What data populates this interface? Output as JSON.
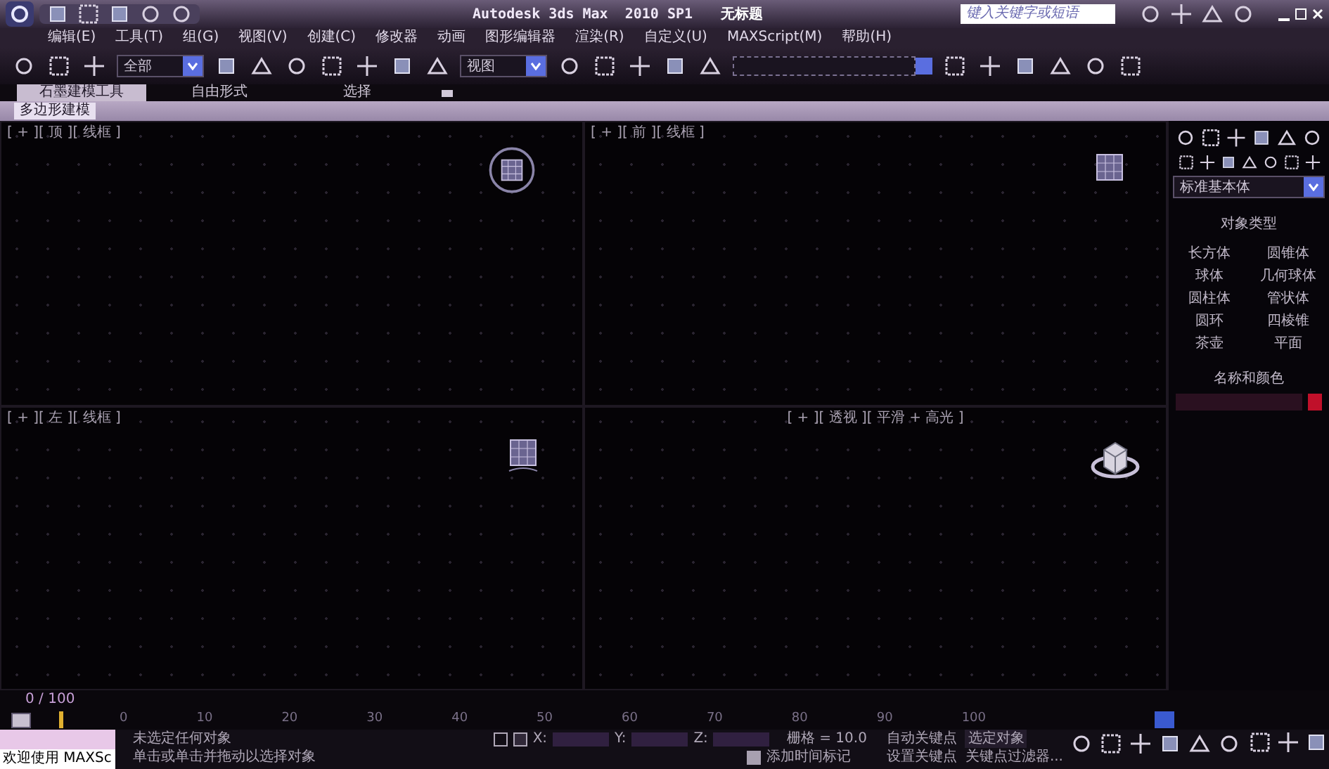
{
  "window": {
    "app_title": "Autodesk 3ds Max  2010 SP1",
    "doc_title": "无标题"
  },
  "search": {
    "placeholder": "键入关键字或短语"
  },
  "menu": [
    "编辑(E)",
    "工具(T)",
    "组(G)",
    "视图(V)",
    "创建(C)",
    "修改器",
    "动画",
    "图形编辑器",
    "渲染(R)",
    "自定义(U)",
    "MAXScript(M)",
    "帮助(H)"
  ],
  "toolbar": {
    "selection_filter": "全部",
    "reference_coord": "视图"
  },
  "ribbon_tabs": [
    {
      "label": "石墨建模工具",
      "selected": true
    },
    {
      "label": "自由形式",
      "selected": false
    },
    {
      "label": "选择",
      "selected": false
    }
  ],
  "ribbon_panel": {
    "label": "多边形建模"
  },
  "viewports": [
    {
      "label": "[ + ][ 顶 ][ 线框 ]",
      "kind": "top"
    },
    {
      "label": "[ + ][ 前 ][ 线框 ]",
      "kind": "front"
    },
    {
      "label": "[ + ][ 左 ][ 线框 ]",
      "kind": "left"
    },
    {
      "label": "[ + ][ 透视 ][ 平滑 + 高光 ]",
      "kind": "perspective"
    }
  ],
  "command_panel": {
    "category": "标准基本体",
    "object_type_title": "对象类型",
    "buttons": [
      "长方体",
      "圆锥体",
      "球体",
      "几何球体",
      "圆柱体",
      "管状体",
      "圆环",
      "四棱锥",
      "茶壶",
      "平面"
    ],
    "name_color_title": "名称和颜色"
  },
  "time_slider": {
    "label": "0 / 100"
  },
  "timeline_ticks": [
    "0",
    "10",
    "20",
    "30",
    "40",
    "50",
    "60",
    "70",
    "80",
    "90",
    "100"
  ],
  "status": {
    "welcome": "欢迎使用 MAXSc",
    "selection": "未选定任何对象",
    "prompt": "单击或单击并拖动以选择对象",
    "x_label": "X:",
    "y_label": "Y:",
    "z_label": "Z:",
    "grid": "栅格 = 10.0",
    "add_time_tag": "添加时间标记",
    "auto_key": "自动关键点",
    "key_mode": "选定对象",
    "set_key": "设置关键点",
    "key_filters": "关键点过滤器..."
  }
}
